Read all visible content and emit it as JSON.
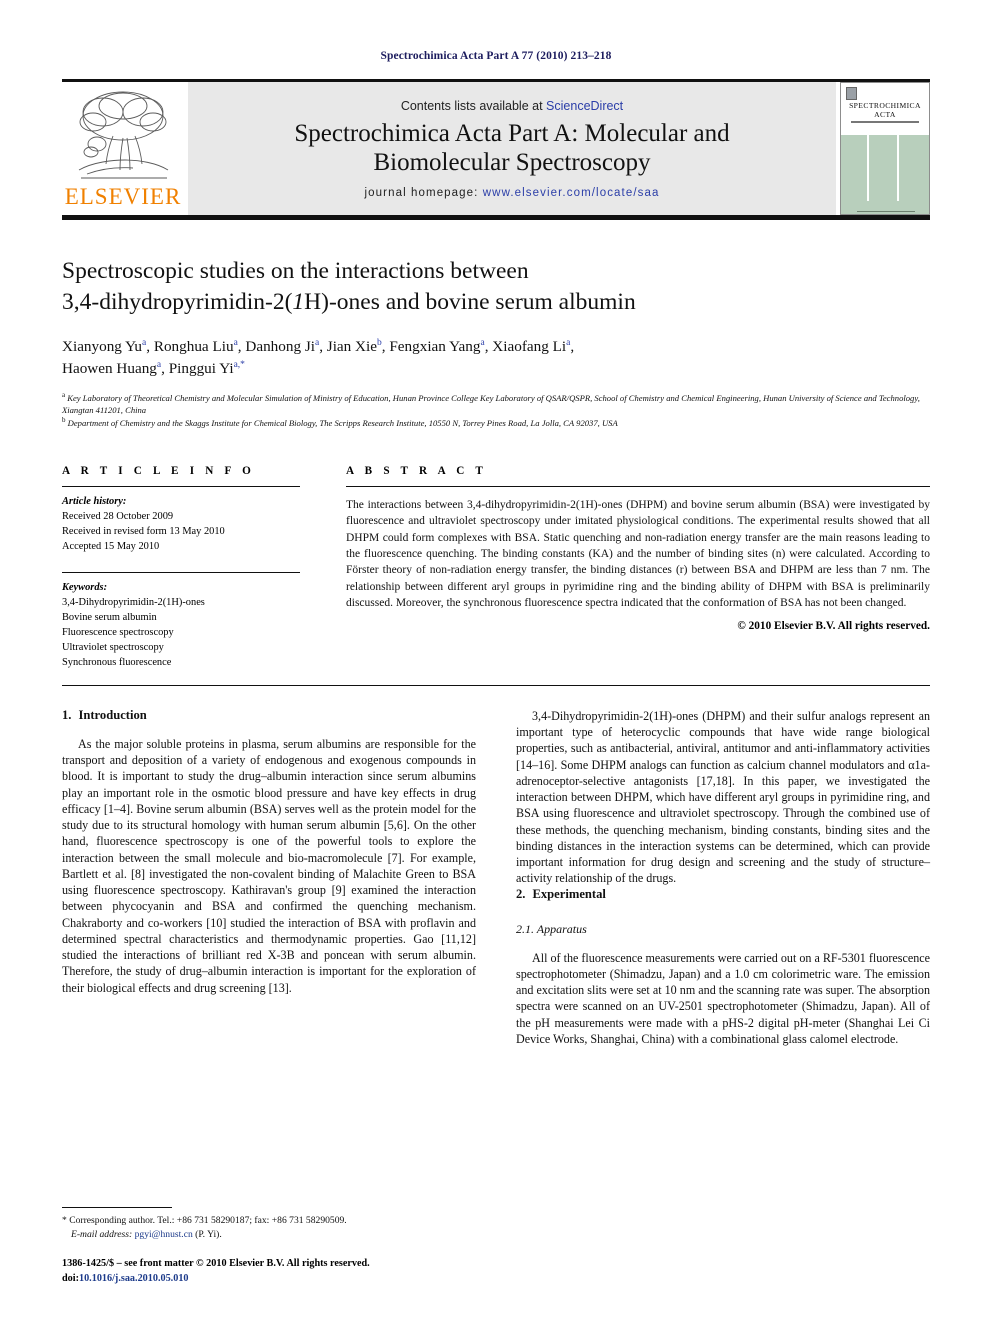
{
  "running_head": "Spectrochimica Acta Part A 77 (2010) 213–218",
  "masthead": {
    "publisher_name": "ELSEVIER",
    "contents_prefix": "Contents lists available at",
    "sciencedirect": "ScienceDirect",
    "journal_title_line1": "Spectrochimica Acta Part A: Molecular and",
    "journal_title_line2": "Biomolecular Spectroscopy",
    "homepage_label": "journal homepage:",
    "homepage_url": "www.elsevier.com/locate/saa",
    "cover": {
      "line1": "SPECTROCHIMICA",
      "line2": "ACTA"
    }
  },
  "article": {
    "title_line1": "Spectroscopic studies on the interactions between",
    "title_line2_a": "3,4-dihydropyrimidin-2(",
    "title_line2_italic": "1",
    "title_line2_b": "H)-ones and bovine serum albumin",
    "authors": [
      {
        "name": "Xianyong Yu",
        "sup": "a",
        "sep": ", "
      },
      {
        "name": "Ronghua Liu",
        "sup": "a",
        "sep": ", "
      },
      {
        "name": "Danhong Ji",
        "sup": "a",
        "sep": ", "
      },
      {
        "name": "Jian Xie",
        "sup": "b",
        "sep": ", "
      },
      {
        "name": "Fengxian Yang",
        "sup": "a",
        "sep": ", "
      },
      {
        "name": "Xiaofang Li",
        "sup": "a",
        "sep": ","
      },
      {
        "name": "Haowen Huang",
        "sup": "a",
        "sep": ", "
      },
      {
        "name": "Pinggui Yi",
        "sup": "a,*",
        "sep": ""
      }
    ],
    "affiliations": [
      {
        "marker": "a",
        "text": "Key Laboratory of Theoretical Chemistry and Molecular Simulation of Ministry of Education, Hunan Province College Key Laboratory of QSAR/QSPR, School of Chemistry and Chemical Engineering, Hunan University of Science and Technology, Xiangtan 411201, China"
      },
      {
        "marker": "b",
        "text": "Department of Chemistry and the Skaggs Institute for Chemical Biology, The Scripps Research Institute, 10550 N, Torrey Pines Road, La Jolla, CA 92037, USA"
      }
    ]
  },
  "article_info": {
    "heading": "A R T I C L E    I N F O",
    "history_label": "Article history:",
    "history": [
      "Received 28 October 2009",
      "Received in revised form 13 May 2010",
      "Accepted 15 May 2010"
    ],
    "keywords_label": "Keywords:",
    "keywords": [
      "3,4-Dihydropyrimidin-2(1H)-ones",
      "Bovine serum albumin",
      "Fluorescence spectroscopy",
      "Ultraviolet spectroscopy",
      "Synchronous fluorescence"
    ]
  },
  "abstract": {
    "heading": "A B S T R A C T",
    "text": "The interactions between 3,4-dihydropyrimidin-2(1H)-ones (DHPM) and bovine serum albumin (BSA) were investigated by fluorescence and ultraviolet spectroscopy under imitated physiological conditions. The experimental results showed that all DHPM could form complexes with BSA. Static quenching and non-radiation energy transfer are the main reasons leading to the fluorescence quenching. The binding constants (KA) and the number of binding sites (n) were calculated. According to Förster theory of non-radiation energy transfer, the binding distances (r) between BSA and DHPM are less than 7 nm. The relationship between different aryl groups in pyrimidine ring and the binding ability of DHPM with BSA is preliminarily discussed. Moreover, the synchronous fluorescence spectra indicated that the conformation of BSA has not been changed.",
    "copyright": "© 2010 Elsevier B.V. All rights reserved."
  },
  "sections": {
    "introduction": {
      "number": "1.",
      "title": "Introduction",
      "paragraph1": "As the major soluble proteins in plasma, serum albumins are responsible for the transport and deposition of a variety of endogenous and exogenous compounds in blood. It is important to study the drug–albumin interaction since serum albumins play an important role in the osmotic blood pressure and have key effects in drug efficacy [1–4]. Bovine serum albumin (BSA) serves well as the protein model for the study due to its structural homology with human serum albumin [5,6]. On the other hand, fluorescence spectroscopy is one of the powerful tools to explore the interaction between the small molecule and bio-macromolecule [7]. For example, Bartlett et al. [8] investigated the non-covalent binding of Malachite Green to BSA using fluorescence spectroscopy. Kathiravan's group [9] examined the interaction between phycocyanin and BSA and confirmed the quenching mechanism. Chakraborty and co-workers [10] studied the interaction of BSA with proflavin and determined spectral characteristics and thermodynamic properties. Gao [11,12] studied the interactions of brilliant red X-3B and poncean with serum albumin. Therefore, the study of drug–albumin interaction is important for the exploration of their biological effects and drug screening [13].",
      "paragraph2": "3,4-Dihydropyrimidin-2(1H)-ones (DHPM) and their sulfur analogs represent an important type of heterocyclic compounds that have wide range biological properties, such as antibacterial, antiviral, antitumor and anti-inflammatory activities [14–16]. Some DHPM analogs can function as calcium channel modulators and α1a-adrenoceptor-selective antagonists [17,18]. In this paper, we investigated the interaction between DHPM, which have different aryl groups in pyrimidine ring, and BSA using fluorescence and ultraviolet spectroscopy. Through the combined use of these methods, the quenching mechanism, binding constants, binding sites and the binding distances in the interaction systems can be determined, which can provide important information for drug design and screening and the study of structure–activity relationship of the drugs."
    },
    "experimental": {
      "number": "2.",
      "title": "Experimental",
      "subsection_number": "2.1.",
      "subsection_title": "Apparatus",
      "paragraph1": "All of the fluorescence measurements were carried out on a RF-5301 fluorescence spectrophotometer (Shimadzu, Japan) and a 1.0 cm colorimetric ware. The emission and excitation slits were set at 10 nm and the scanning rate was super. The absorption spectra were scanned on an UV-2501 spectrophotometer (Shimadzu, Japan). All of the pH measurements were made with a pHS-2 digital pH-meter (Shanghai Lei Ci Device Works, Shanghai, China) with a combinational glass calomel electrode."
    }
  },
  "footnote": {
    "corresponding": "* Corresponding author. Tel.: +86 731 58290187; fax: +86 731 58290509.",
    "email_label": "E-mail address:",
    "email": "pgyi@hnust.cn",
    "email_suffix": "(P. Yi)."
  },
  "imprint": {
    "line1": "1386-1425/$ – see front matter © 2010 Elsevier B.V. All rights reserved.",
    "doi_label": "doi:",
    "doi": "10.1016/j.saa.2010.05.010"
  },
  "colors": {
    "link": "#1c3a8a",
    "elsevier_orange": "#F08000",
    "masthead_bg": "#e8e8e8",
    "cover_green": "#b8cfbc"
  }
}
